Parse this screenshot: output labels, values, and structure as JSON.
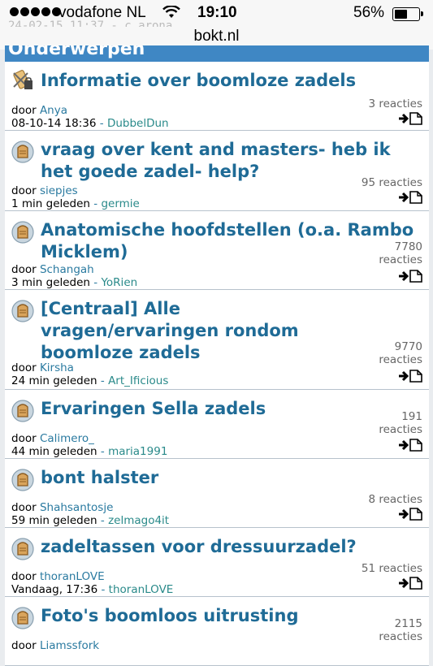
{
  "status_bar": {
    "carrier": "vodafone NL",
    "time": "19:10",
    "battery_pct": "56%",
    "battery_level": 0.56,
    "ghost_text": "24-02-15 11:37 - c_arona"
  },
  "browser": {
    "url": "bokt.nl"
  },
  "section": {
    "title": "Onderwerpen"
  },
  "topics": [
    {
      "title": "Informatie over boomloze zadels",
      "by_label": "door",
      "author": "Anya",
      "time": "08-10-14 18:36",
      "sep": " - ",
      "last_user": "DubbelDun",
      "count": "3 reacties",
      "icon": "pinned-topic-icon"
    },
    {
      "title": "vraag over kent and masters- heb ik het goede zadel- help?",
      "by_label": "door",
      "author": "siepjes",
      "time": "1 min geleden",
      "sep": " - ",
      "last_user": "germie",
      "count": "95 reacties",
      "icon": "topic-icon"
    },
    {
      "title": "Anatomische hoofdstellen (o.a. Rambo Micklem)",
      "by_label": "door",
      "author": "Schangah",
      "time": "3 min geleden",
      "sep": " - ",
      "last_user": "YoRien",
      "count": "7780 reacties",
      "icon": "topic-icon"
    },
    {
      "title": "[Centraal] Alle vragen/ervaringen rondom boomloze zadels",
      "by_label": "door",
      "author": "Kirsha",
      "time": "24 min geleden",
      "sep": " - ",
      "last_user": "Art_Ificious",
      "count": "9770 reacties",
      "icon": "topic-icon"
    },
    {
      "title": "Ervaringen Sella zadels",
      "by_label": "door",
      "author": "Calimero_",
      "time": "44 min geleden",
      "sep": " - ",
      "last_user": "maria1991",
      "count": "191 reacties",
      "icon": "topic-icon"
    },
    {
      "title": "bont halster",
      "by_label": "door",
      "author": "Shahsantosje",
      "time": "59 min geleden",
      "sep": " - ",
      "last_user": "zelmago4it",
      "count": "8 reacties",
      "icon": "topic-icon"
    },
    {
      "title": "zadeltassen voor dressuurzadel?",
      "by_label": "door",
      "author": "thoranLOVE",
      "time": "Vandaag, 17:36",
      "sep": " - ",
      "last_user": "thoranLOVE",
      "count": "51 reacties",
      "icon": "topic-icon"
    },
    {
      "title": "Foto's boomloos uitrusting",
      "by_label": "door",
      "author": "Liamssfork",
      "time": "",
      "sep": "",
      "last_user": "",
      "count": "2115 reacties",
      "icon": "topic-icon"
    }
  ]
}
